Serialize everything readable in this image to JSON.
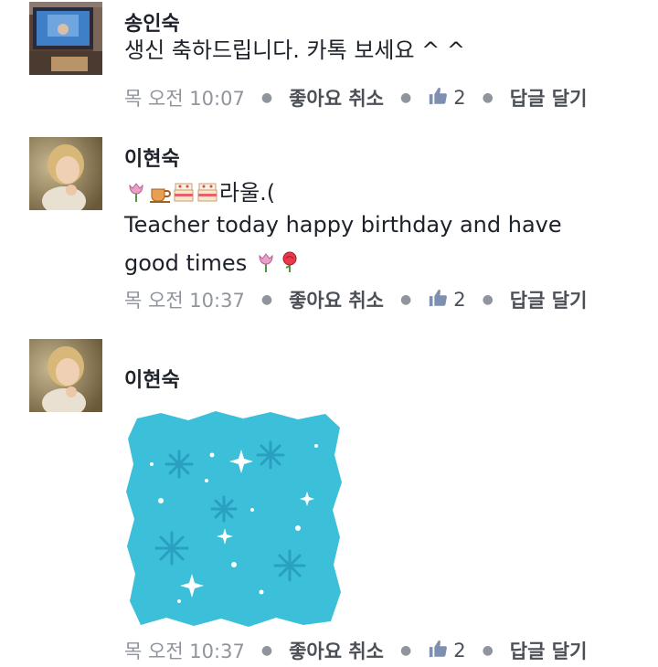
{
  "comments": [
    {
      "author": "송인숙",
      "text": "생신 축하드립니다.  카톡 보세요 ^ ^",
      "time": "목 오전 10:07",
      "like_action": "좋아요 취소",
      "like_count": "2",
      "reply_action": "답글 달기"
    },
    {
      "author": "이현숙",
      "text_suffix": "라울.(",
      "text_line2": "Teacher today happy birthday and  have",
      "text_line3": "good times",
      "emojis_line1": [
        "tulip-icon",
        "coffee-icon",
        "cake-icon",
        "cake-icon"
      ],
      "emojis_line3": [
        "tulip-icon",
        "rose-icon"
      ],
      "time": "목 오전 10:37",
      "like_action": "좋아요 취소",
      "like_count": "2",
      "reply_action": "답글 달기"
    },
    {
      "author": "이현숙",
      "time": "목 오전 10:37",
      "like_action": "좋아요 취소",
      "like_count": "2",
      "reply_action": "답글 달기"
    }
  ],
  "colors": {
    "meta_text": "#90949c",
    "action_text": "#4b4f56",
    "name_text": "#1d2129",
    "snow_blue": "#3cbfd8"
  }
}
